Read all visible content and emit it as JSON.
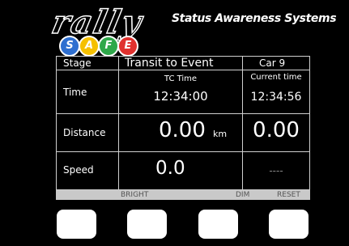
{
  "header": {
    "logo_word": "rally",
    "logo_letters": [
      "S",
      "A",
      "F",
      "E"
    ],
    "logo_letter_colors": [
      "#2e6fd0",
      "#f5c000",
      "#2fa84a",
      "#e0312e"
    ],
    "tagline": "Status Awareness Systems"
  },
  "table": {
    "stage_label": "Stage",
    "stage_value": "Transit to Event",
    "car": "Car 9",
    "time_label": "Time",
    "tc_time_label": "TC Time",
    "tc_time_value": "12:34:00",
    "current_time_label": "Current time",
    "current_time_value": "12:34:56",
    "distance_label": "Distance",
    "distance_value": "0.00",
    "distance_unit": "km",
    "distance_right": "0.00",
    "speed_label": "Speed",
    "speed_value": "0.0",
    "speed_right": "----"
  },
  "softkeys": {
    "bright": "BRIGHT",
    "dim": "DIM",
    "reset": "RESET"
  }
}
